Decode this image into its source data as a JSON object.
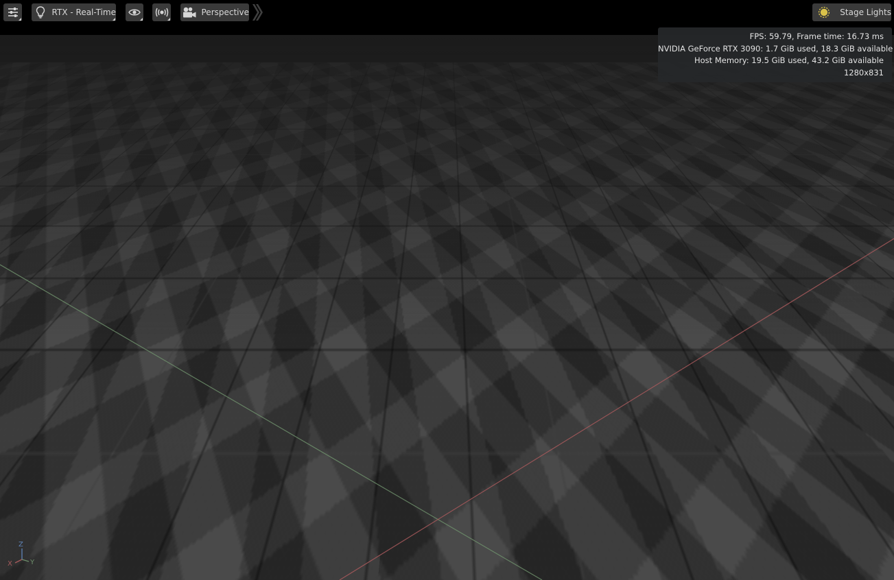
{
  "toolbar": {
    "settings_icon": "sliders-icon",
    "renderer_icon": "lightbulb-icon",
    "renderer_label": "RTX - Real-Time",
    "visibility_icon": "eye-icon",
    "live_icon": "broadcast-icon",
    "camera_icon": "movie-camera-icon",
    "camera_label": "Perspective",
    "expand_icon": "double-chevron-right-icon",
    "lights_icon": "sun-icon",
    "lights_label": "Stage Lights"
  },
  "hud": {
    "fps": "FPS: 59.79, Frame time: 16.73 ms",
    "gpu": "NVIDIA GeForce RTX 3090: 1.7 GiB used, 18.3 GiB available",
    "host": "Host Memory: 19.5 GiB used, 43.2 GiB available",
    "resolution": "1280x831"
  },
  "gizmo": {
    "x": "X",
    "y": "Y",
    "z": "Z"
  },
  "colors": {
    "x_axis": "#a85a5c",
    "y_axis": "#6e8f6b",
    "z_axis": "#5f83b8",
    "sun": "#d9c24a"
  }
}
